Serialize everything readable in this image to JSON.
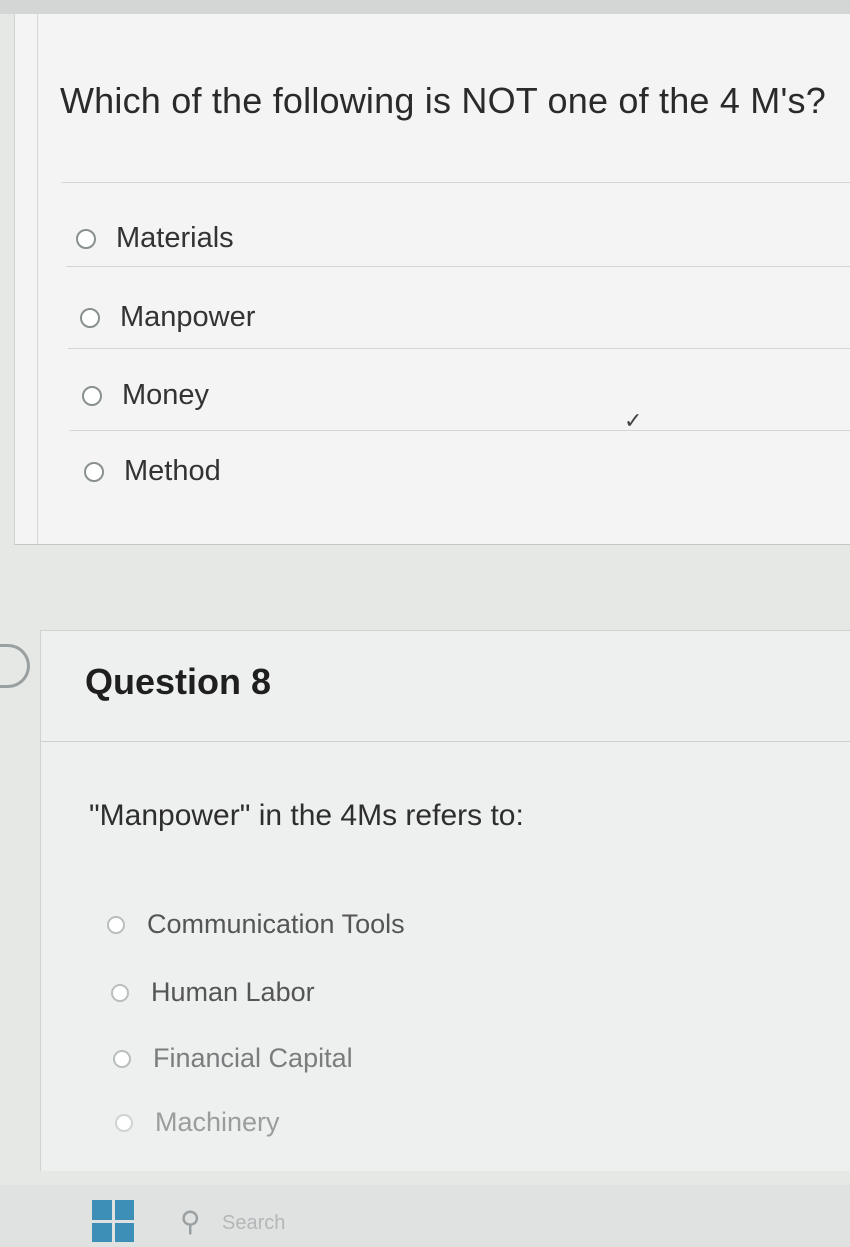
{
  "question7": {
    "text": "Which of the following is NOT one of the 4 M's?",
    "options": [
      {
        "label": "Materials"
      },
      {
        "label": "Manpower"
      },
      {
        "label": "Money"
      },
      {
        "label": "Method"
      }
    ],
    "check_mark": "✓"
  },
  "question8": {
    "title": "Question 8",
    "text": "\"Manpower\" in the 4Ms refers to:",
    "options": [
      {
        "label": "Communication Tools"
      },
      {
        "label": "Human Labor"
      },
      {
        "label": "Financial Capital"
      },
      {
        "label": "Machinery"
      }
    ]
  },
  "taskbar": {
    "search_placeholder": "Search",
    "colors": {
      "windows_logo": "#3d8fb8"
    }
  },
  "icons": [
    "radio-icon",
    "check-icon",
    "flag-icon",
    "windows-icon",
    "search-icon"
  ]
}
